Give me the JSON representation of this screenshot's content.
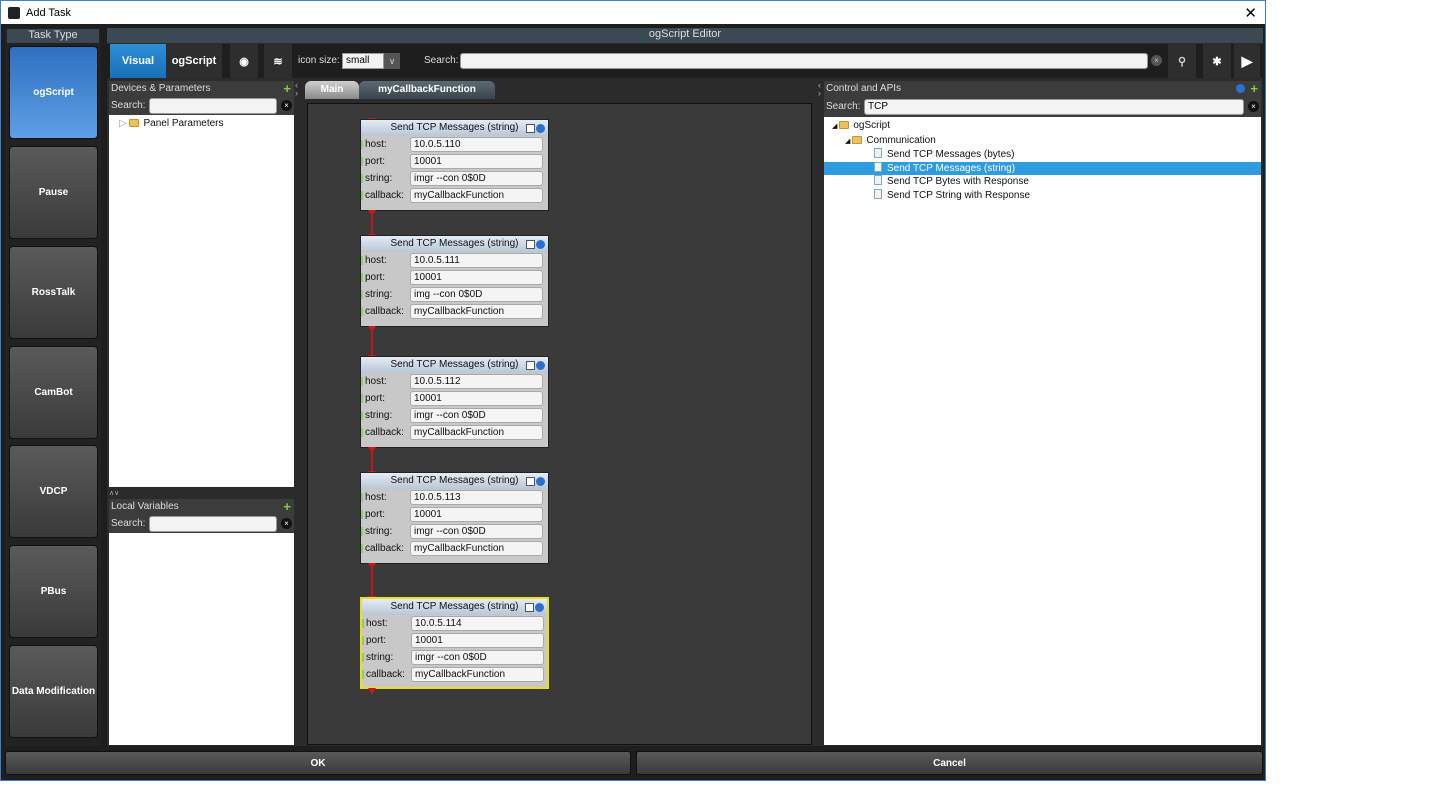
{
  "window": {
    "title": "Add Task"
  },
  "task_type": {
    "header": "Task Type",
    "items": [
      {
        "label": "ogScript",
        "selected": true
      },
      {
        "label": "Pause"
      },
      {
        "label": "RossTalk"
      },
      {
        "label": "CamBot"
      },
      {
        "label": "VDCP"
      },
      {
        "label": "PBus"
      },
      {
        "label": "Data Modification"
      }
    ]
  },
  "editor": {
    "title": "ogScript Editor",
    "visual_label": "Visual",
    "ogscript_label": "ogScript",
    "icon_size_label": "icon size:",
    "icon_size_value": "small",
    "search_label": "Search:",
    "search_value": ""
  },
  "devices": {
    "title": "Devices & Parameters",
    "search_label": "Search:",
    "search_value": "",
    "tree": [
      "Panel Parameters"
    ]
  },
  "locals": {
    "title": "Local Variables",
    "search_label": "Search:",
    "search_value": ""
  },
  "tabs": [
    {
      "label": "Main",
      "active": true
    },
    {
      "label": "myCallbackFunction"
    }
  ],
  "blocks": [
    {
      "title": "Send TCP Messages (string)",
      "host": "10.0.5.110",
      "port": "10001",
      "string": "imgr --con 0$0D",
      "callback": "myCallbackFunction"
    },
    {
      "title": "Send TCP Messages (string)",
      "host": "10.0.5.111",
      "port": "10001",
      "string": "img --con 0$0D",
      "callback": "myCallbackFunction"
    },
    {
      "title": "Send TCP Messages (string)",
      "host": "10.0.5.112",
      "port": "10001",
      "string": "imgr --con 0$0D",
      "callback": "myCallbackFunction"
    },
    {
      "title": "Send TCP Messages (string)",
      "host": "10.0.5.113",
      "port": "10001",
      "string": "imgr --con 0$0D",
      "callback": "myCallbackFunction"
    },
    {
      "title": "Send TCP Messages (string)",
      "host": "10.0.5.114",
      "port": "10001",
      "string": "imgr --con 0$0D",
      "callback": "myCallbackFunction",
      "selected": true
    }
  ],
  "field_labels": {
    "host": "host:",
    "port": "port:",
    "string": "string:",
    "callback": "callback:"
  },
  "apis": {
    "title": "Control and APIs",
    "search_label": "Search:",
    "search_value": "TCP",
    "root": "ogScript",
    "group": "Communication",
    "items": [
      "Send TCP Messages (bytes)",
      "Send TCP Messages (string)",
      "Send TCP Bytes with Response",
      "Send TCP String with Response"
    ],
    "selected_index": 1
  },
  "buttons": {
    "ok": "OK",
    "cancel": "Cancel"
  }
}
